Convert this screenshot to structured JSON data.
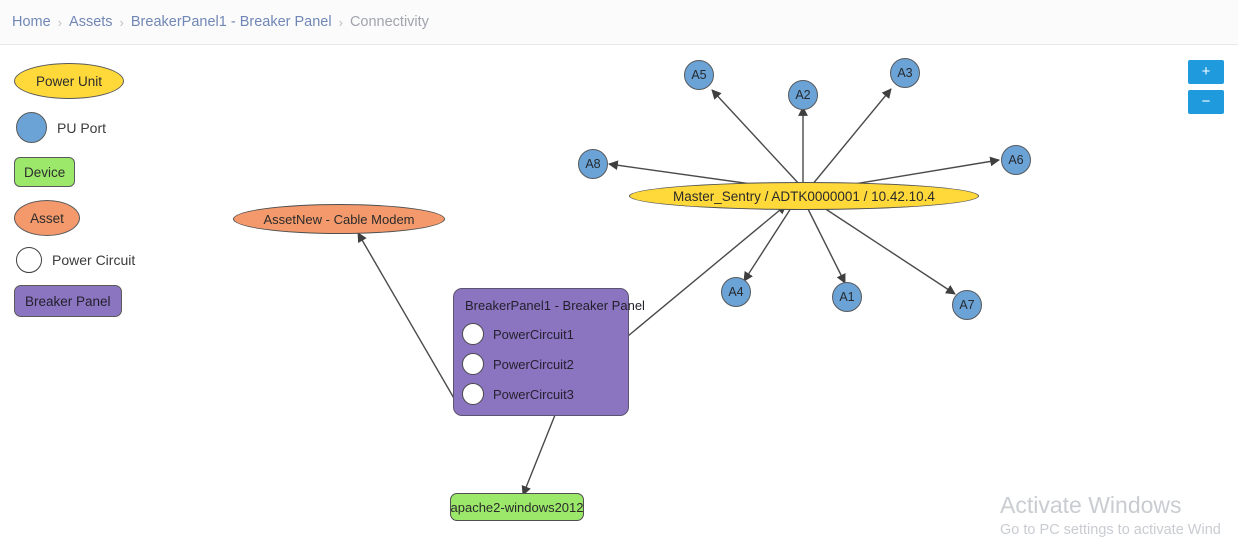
{
  "breadcrumb": {
    "items": [
      {
        "label": "Home",
        "current": false
      },
      {
        "label": "Assets",
        "current": false
      },
      {
        "label": "BreakerPanel1 - Breaker Panel",
        "current": false
      },
      {
        "label": "Connectivity",
        "current": true
      }
    ],
    "separator": "›"
  },
  "legend": {
    "items": [
      {
        "label": "Power Unit",
        "shape": "ellipse",
        "color": "#ffd83a",
        "inside": true
      },
      {
        "label": "PU Port",
        "shape": "circle",
        "color": "#6ba3d6",
        "inside": false
      },
      {
        "label": "Device",
        "shape": "rect",
        "color": "#9be86a",
        "inside": true
      },
      {
        "label": "Asset",
        "shape": "ellipse",
        "color": "#f4996b",
        "inside": true
      },
      {
        "label": "Power Circuit",
        "shape": "circle",
        "color": "#ffffff",
        "inside": false
      },
      {
        "label": "Breaker Panel",
        "shape": "rect",
        "color": "#8b75c0",
        "inside": true
      }
    ]
  },
  "graph": {
    "power_unit": {
      "label": "Master_Sentry / ADTK0000001 / 10.42.10.4"
    },
    "ports": [
      {
        "label": "A5"
      },
      {
        "label": "A2"
      },
      {
        "label": "A3"
      },
      {
        "label": "A8"
      },
      {
        "label": "A6"
      },
      {
        "label": "A4"
      },
      {
        "label": "A1"
      },
      {
        "label": "A7"
      }
    ],
    "asset": {
      "label": "AssetNew - Cable Modem"
    },
    "device": {
      "label": "apache2-windows2012"
    },
    "breaker_panel": {
      "title": "BreakerPanel1 - Breaker Panel",
      "circuits": [
        {
          "label": "PowerCircuit1"
        },
        {
          "label": "PowerCircuit2"
        },
        {
          "label": "PowerCircuit3"
        }
      ]
    }
  },
  "zoom_controls": {
    "zoom_in_label": "+",
    "zoom_out_label": "−"
  },
  "watermark": {
    "title": "Activate Windows",
    "subtitle": "Go to PC settings to activate Wind"
  }
}
